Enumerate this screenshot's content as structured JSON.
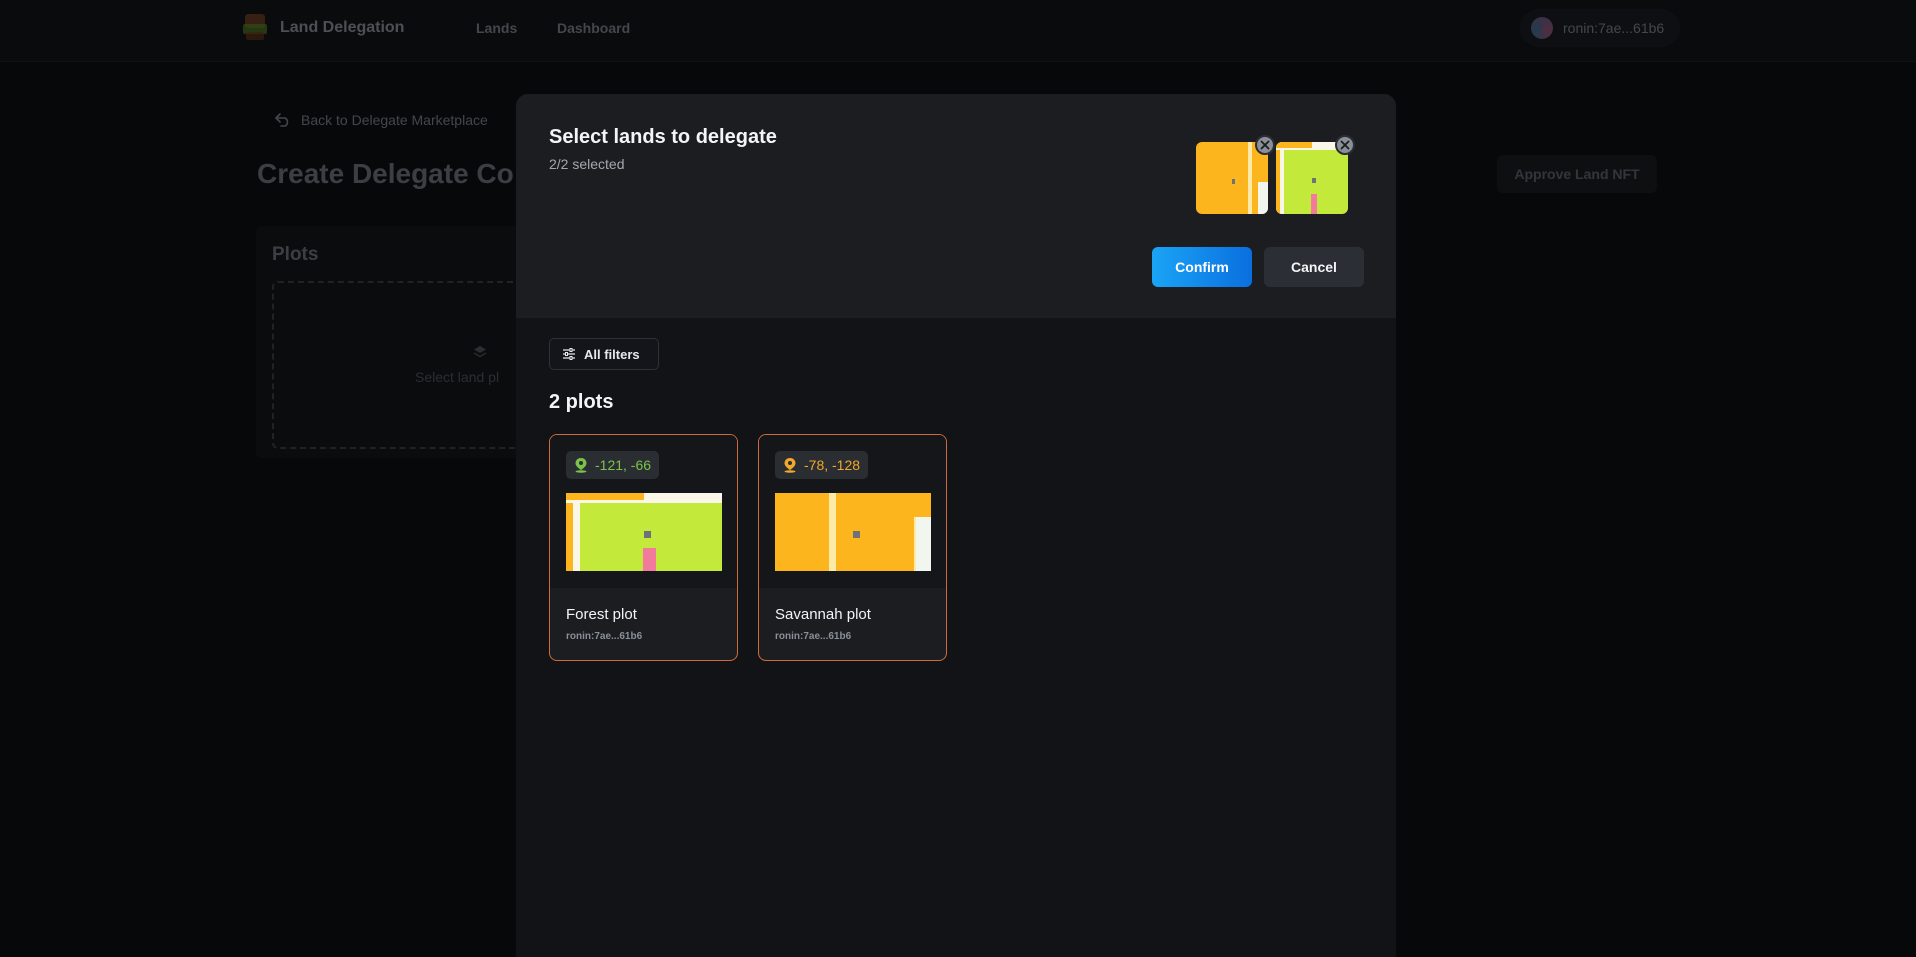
{
  "topbar": {
    "brand": "Land Delegation",
    "nav": [
      "Lands",
      "Dashboard"
    ],
    "wallet": "ronin:7ae...61b6"
  },
  "background": {
    "back_link": "Back to Delegate Marketplace",
    "page_title": "Create Delegate Co",
    "approve_button": "Approve Land NFT",
    "plots_heading": "Plots",
    "dropzone_text": "Select land pl"
  },
  "modal": {
    "title": "Select lands to delegate",
    "subtitle": "2/2 selected",
    "confirm": "Confirm",
    "cancel": "Cancel",
    "filters": "All filters",
    "count": "2 plots"
  },
  "plots": [
    {
      "coords": "-121, -66",
      "name": "Forest plot",
      "owner": "ronin:7ae...61b6",
      "color": "#c3ea3b"
    },
    {
      "coords": "-78, -128",
      "name": "Savannah plot",
      "owner": "ronin:7ae...61b6",
      "color": "#fdb51e"
    }
  ],
  "colors": {
    "accent_start": "#1aa4f5",
    "accent_end": "#0a6fe0",
    "card_border": "#d06a3a",
    "forest": "#7cc24a",
    "savannah": "#f2a82b"
  }
}
